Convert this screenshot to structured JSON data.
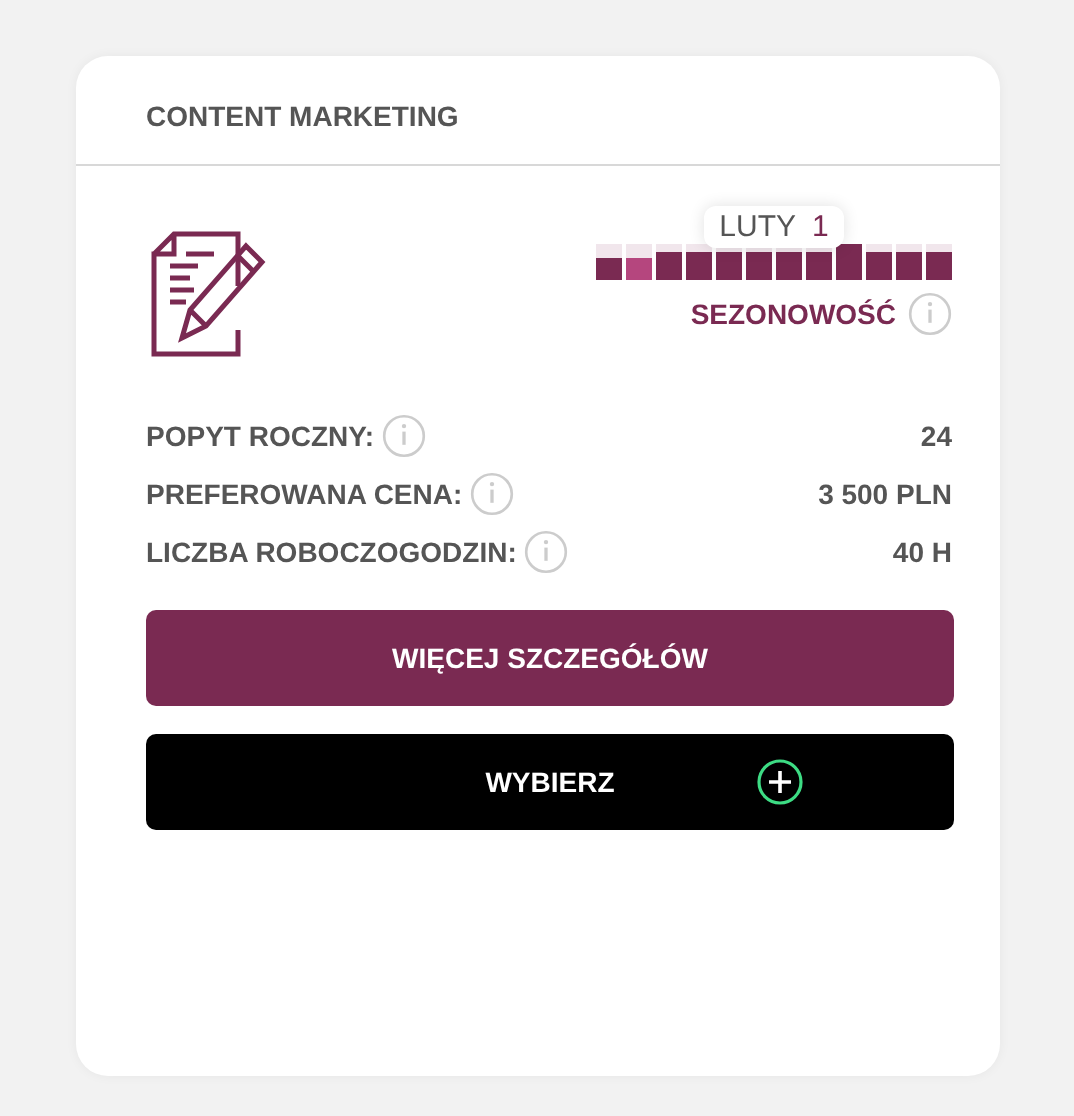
{
  "card": {
    "title": "CONTENT MARKETING"
  },
  "seasonality": {
    "label": "SEZONOWOŚĆ",
    "tooltip_month": "LUTY",
    "tooltip_value": "1",
    "bars": [
      {
        "level": 0.6,
        "selected": false
      },
      {
        "level": 0.6,
        "selected": true
      },
      {
        "level": 0.8,
        "selected": false
      },
      {
        "level": 0.8,
        "selected": false
      },
      {
        "level": 0.8,
        "selected": false
      },
      {
        "level": 0.8,
        "selected": false
      },
      {
        "level": 0.8,
        "selected": false
      },
      {
        "level": 0.8,
        "selected": false
      },
      {
        "level": 1.0,
        "selected": false
      },
      {
        "level": 0.8,
        "selected": false
      },
      {
        "level": 0.8,
        "selected": false
      },
      {
        "level": 0.8,
        "selected": false
      }
    ]
  },
  "stats": [
    {
      "label": "POPYT ROCZNY:",
      "value": "24"
    },
    {
      "label": "PREFEROWANA CENA:",
      "value": "3 500 PLN"
    },
    {
      "label": "LICZBA ROBOCZOGODZIN:",
      "value": "40 H"
    }
  ],
  "buttons": [
    {
      "kind": "details",
      "label": "WIĘCEJ SZCZEGÓŁÓW"
    },
    {
      "kind": "select",
      "label": "WYBIERZ"
    }
  ]
}
